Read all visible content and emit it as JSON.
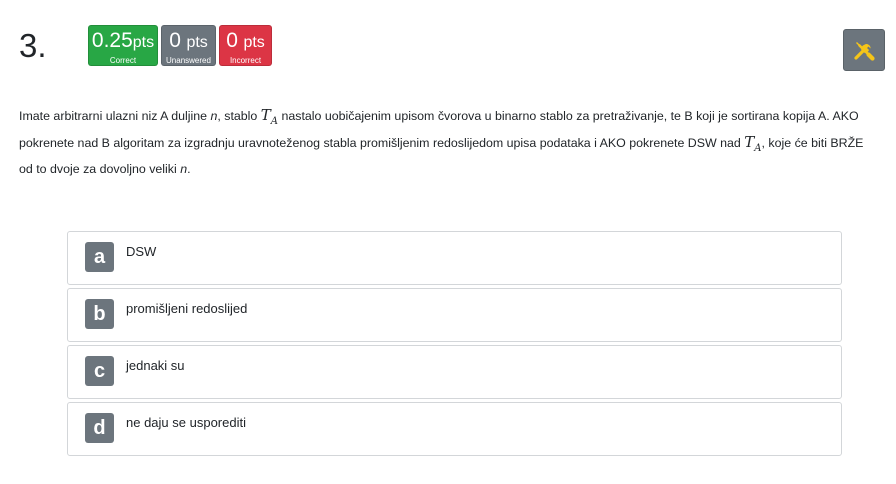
{
  "question_number": "3.",
  "badges": {
    "correct": {
      "num": "0.25",
      "unit": "pts",
      "caption": "Correct",
      "color": "#28a745"
    },
    "unanswered": {
      "num": "0",
      "unit": "pts",
      "caption": "Unanswered",
      "color": "#6c757d"
    },
    "incorrect": {
      "num": "0",
      "unit": "pts",
      "caption": "Incorrect",
      "color": "#dc3545"
    }
  },
  "tool_button": {
    "icon": "tools-icon"
  },
  "question": {
    "p1": "Imate arbitrarni ulazni niz A duljine ",
    "n1": "n",
    "p2": ", stablo ",
    "T1": "T",
    "T1_sub": "A",
    "p3": " nastalo uobičajenim upisom čvorova u binarno stablo za pretraživanje, te B koji je sortirana kopija A. AKO pokrenete nad B algoritam za izgradnju uravnoteženog stabla promišljenim redoslijedom upisa podataka i AKO pokrenete DSW nad ",
    "T2": "T",
    "T2_sub": "A",
    "p4": ", koje će biti BRŽE od to dvoje za dovoljno veliki ",
    "n2": "n",
    "p5": "."
  },
  "answers": [
    {
      "letter": "a",
      "text": "DSW"
    },
    {
      "letter": "b",
      "text": "promišljeni redoslijed"
    },
    {
      "letter": "c",
      "text": "jednaki su"
    },
    {
      "letter": "d",
      "text": "ne daju se usporediti"
    }
  ]
}
